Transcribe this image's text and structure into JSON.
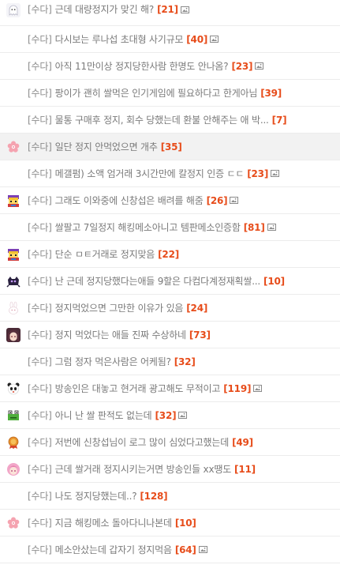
{
  "category_label": "[수다]",
  "posts": [
    {
      "title": "근데 대량정지가 맞긴 해?",
      "count": "[21]",
      "avatar": "ghost-avatar-icon",
      "has_image": true
    },
    {
      "title": "다시보는 루나섭 초대형 사기규모",
      "count": "[40]",
      "avatar": "",
      "has_image": true
    },
    {
      "title": "아직 11만이상 정지당한사람 한명도 안나옴?",
      "count": "[23]",
      "avatar": "",
      "has_image": true
    },
    {
      "title": "팡이가 괜히 쌀먹은 인기게임에 필요하다고 한게아님",
      "count": "[39]",
      "avatar": "",
      "has_image": false
    },
    {
      "title": "물통 구매후 정지, 회수 당했는데 환불 안해주는 애 박...",
      "count": "[7]",
      "avatar": "",
      "has_image": false
    },
    {
      "title": "일단 정지 안먹었으면 개추",
      "count": "[35]",
      "avatar": "flower-avatar-icon",
      "has_image": false
    },
    {
      "title": "메갤펌) 소액 엄거래 3시간만에 칼정지 인증 ㄷㄷ",
      "count": "[23]",
      "avatar": "",
      "has_image": true
    },
    {
      "title": "그래도 이와중에 신창섭은 배려를 해줌",
      "count": "[26]",
      "avatar": "pixel-character-avatar-icon",
      "has_image": true
    },
    {
      "title": "쌀팔고 7일정지 해킹메소아니고 템판메소인증함",
      "count": "[81]",
      "avatar": "",
      "has_image": true
    },
    {
      "title": "단순 ㅁㅌ거래로 정지맞음",
      "count": "[22]",
      "avatar": "pixel-character-avatar-icon",
      "has_image": false
    },
    {
      "title": "난 근데 정지당했다는애들 9할은 다컴다계정재획쌀...",
      "count": "[10]",
      "avatar": "dark-creature-avatar-icon",
      "has_image": false
    },
    {
      "title": "정지먹었으면 그만한 이유가 있음",
      "count": "[24]",
      "avatar": "white-bunny-avatar-icon",
      "has_image": false
    },
    {
      "title": "정지 먹었다는 애들 진짜 수상하네",
      "count": "[73]",
      "avatar": "anime-girl-avatar-icon",
      "has_image": false
    },
    {
      "title": "그럼 정자 먹은사람은 어케됨?",
      "count": "[32]",
      "avatar": "",
      "has_image": false
    },
    {
      "title": "방송인은 대놓고 현거래 광고해도 무적이고",
      "count": "[119]",
      "avatar": "panda-avatar-icon",
      "has_image": true
    },
    {
      "title": "아니 난 쌀 판적도 없는데",
      "count": "[32]",
      "avatar": "frog-avatar-icon",
      "has_image": true
    },
    {
      "title": "저번에 신창섭님이 로그 많이 심었다고했는데",
      "count": "[49]",
      "avatar": "medal-avatar-icon",
      "has_image": false
    },
    {
      "title": "근데 쌀거래 정지시키는거면 방송인들 xx땡도",
      "count": "[11]",
      "avatar": "pink-hair-avatar-icon",
      "has_image": false
    },
    {
      "title": "나도 정지당했는데..?",
      "count": "[128]",
      "avatar": "",
      "has_image": false
    },
    {
      "title": "지금 해킹메소 돌아다니나본데",
      "count": "[10]",
      "avatar": "flower-avatar-icon",
      "has_image": false
    },
    {
      "title": "메소안샀는데 갑자기 정지먹음",
      "count": "[64]",
      "avatar": "",
      "has_image": true
    }
  ],
  "highlighted_index": 5,
  "colors": {
    "category": "#8c8c8c",
    "title": "#7a7a7a",
    "count": "#e74c1a",
    "divider": "#ececec",
    "highlight_bg": "#f2f2f2"
  }
}
